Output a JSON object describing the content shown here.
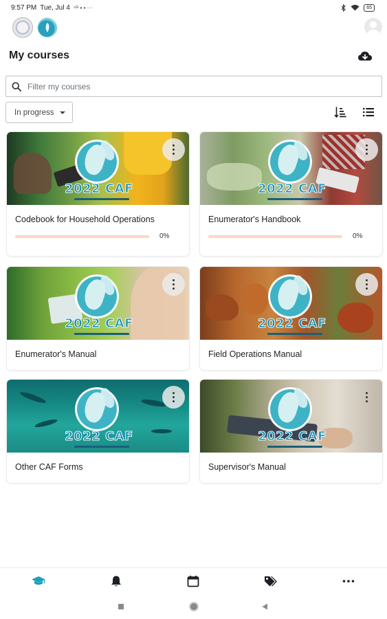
{
  "status_bar": {
    "time": "9:57 PM",
    "date": "Tue, Jul 4",
    "battery": "65"
  },
  "header": {
    "title": "My courses",
    "download_icon": "cloud-download-icon"
  },
  "filter": {
    "placeholder": "Filter my courses",
    "value": ""
  },
  "status_filter": {
    "selected": "In progress"
  },
  "courses": [
    {
      "title": "Codebook for Household Operations",
      "progress": 0,
      "progress_label": "0%",
      "has_progress": true
    },
    {
      "title": "Enumerator's Handbook",
      "progress": 0,
      "progress_label": "0%",
      "has_progress": true
    },
    {
      "title": "Enumerator's Manual",
      "has_progress": false
    },
    {
      "title": "Field Operations Manual",
      "has_progress": false
    },
    {
      "title": "Other CAF Forms",
      "has_progress": false
    },
    {
      "title": "Supervisor's Manual",
      "has_progress": false
    }
  ],
  "course_image_badge": "2022 CAF",
  "colors": {
    "primary": "#0f6cbf",
    "progress_track": "#fbd7c1",
    "nav_active": "#1a9fbf",
    "caf_teal": "#3fb3c6"
  },
  "bottom_nav": [
    {
      "icon": "graduation-cap-icon",
      "active": true
    },
    {
      "icon": "bell-icon",
      "active": false
    },
    {
      "icon": "calendar-icon",
      "active": false
    },
    {
      "icon": "tags-icon",
      "active": false
    },
    {
      "icon": "more-icon",
      "active": false
    }
  ]
}
